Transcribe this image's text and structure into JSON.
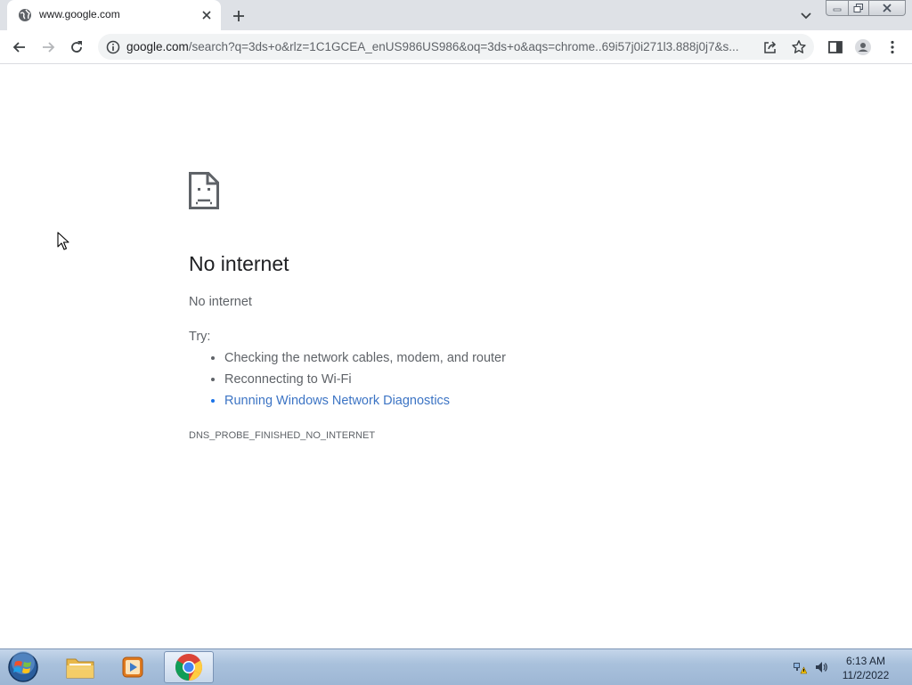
{
  "browser": {
    "tab": {
      "title": "www.google.com"
    },
    "address_bar": {
      "host": "google.com",
      "path": "/search?q=3ds+o&rlz=1C1GCEA_enUS986US986&oq=3ds+o&aqs=chrome..69i57j0i271l3.888j0j7&s..."
    }
  },
  "page": {
    "heading": "No internet",
    "subtitle": "No internet",
    "try_label": "Try:",
    "suggestions": [
      "Checking the network cables, modem, and router",
      "Reconnecting to Wi-Fi",
      "Running Windows Network Diagnostics"
    ],
    "error_code": "DNS_PROBE_FINISHED_NO_INTERNET"
  },
  "taskbar": {
    "clock_time": "6:13 AM",
    "clock_date": "11/2/2022",
    "pinned": [
      "start-orb",
      "windows-explorer",
      "media-player",
      "google-chrome"
    ]
  },
  "colors": {
    "link": "#3c74c4",
    "tabstrip": "#dee1e6",
    "omnibox": "#f1f3f4"
  }
}
